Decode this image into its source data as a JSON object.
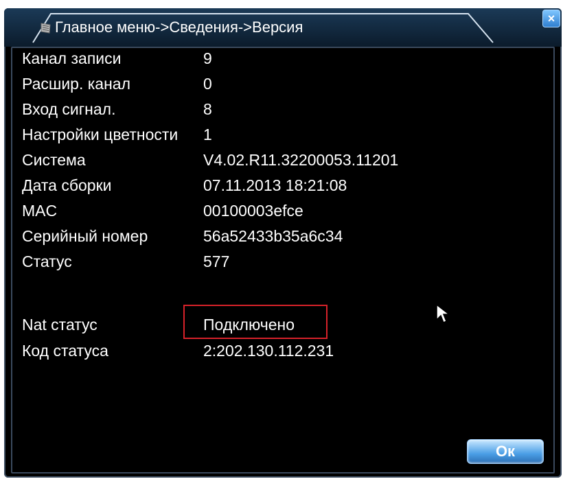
{
  "dialog": {
    "breadcrumb": "Главное меню->Сведения->Версия",
    "close_label": "×",
    "ok_label": "Ок",
    "accent_color": "#2f7fd0",
    "highlight_color": "#d8222a"
  },
  "info": [
    {
      "label": "Канал записи",
      "value": "9"
    },
    {
      "label": "Расшир. канал",
      "value": "0"
    },
    {
      "label": "Вход сигнал.",
      "value": "8"
    },
    {
      "label": "Настройки цветности",
      "value": "1"
    },
    {
      "label": "Система",
      "value": "V4.02.R11.32200053.11201"
    },
    {
      "label": "Дата сборки",
      "value": "07.11.2013 18:21:08"
    },
    {
      "label": "MAC",
      "value": "00100003efce"
    },
    {
      "label": "Серийный номер",
      "value": "56a52433b35a6c34"
    },
    {
      "label": "Статус",
      "value": "577"
    },
    {
      "label": "Nat статус",
      "value": "Подключено"
    },
    {
      "label": "Код статуса",
      "value": "2:202.130.112.231"
    }
  ]
}
